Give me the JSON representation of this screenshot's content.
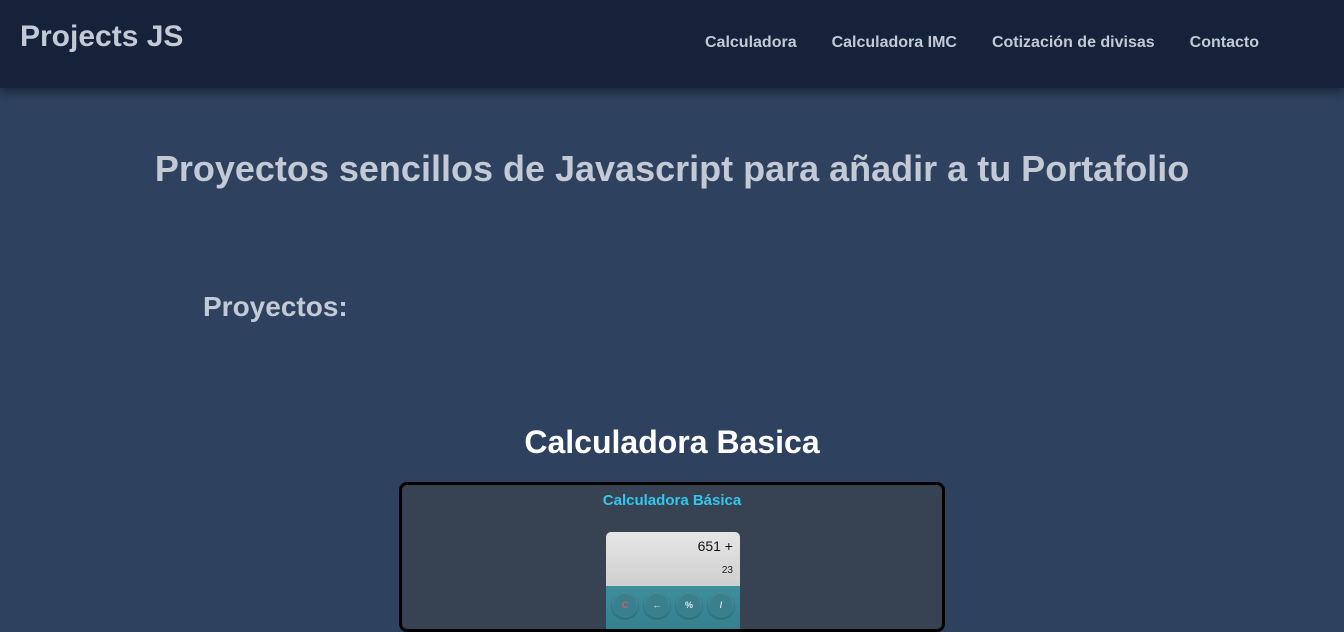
{
  "header": {
    "brand": "Projects JS",
    "nav": [
      {
        "label": "Calculadora"
      },
      {
        "label": "Calculadora IMC"
      },
      {
        "label": "Cotización de divisas"
      },
      {
        "label": "Contacto"
      }
    ]
  },
  "main": {
    "title": "Proyectos sencillos de Javascript para añadir a tu Portafolio",
    "section_title": "Proyectos:",
    "projects": [
      {
        "title": "Calculadora Basica",
        "preview": {
          "app_title": "Calculadora Básica",
          "expression": "651 +",
          "result": "23",
          "keys": [
            "C",
            "←",
            "%",
            "/"
          ]
        }
      }
    ]
  },
  "colors": {
    "page_bg": "#2e4260",
    "navbar_bg": "#15223a",
    "text_muted": "#c3cad6",
    "accent": "#32c8ee"
  }
}
